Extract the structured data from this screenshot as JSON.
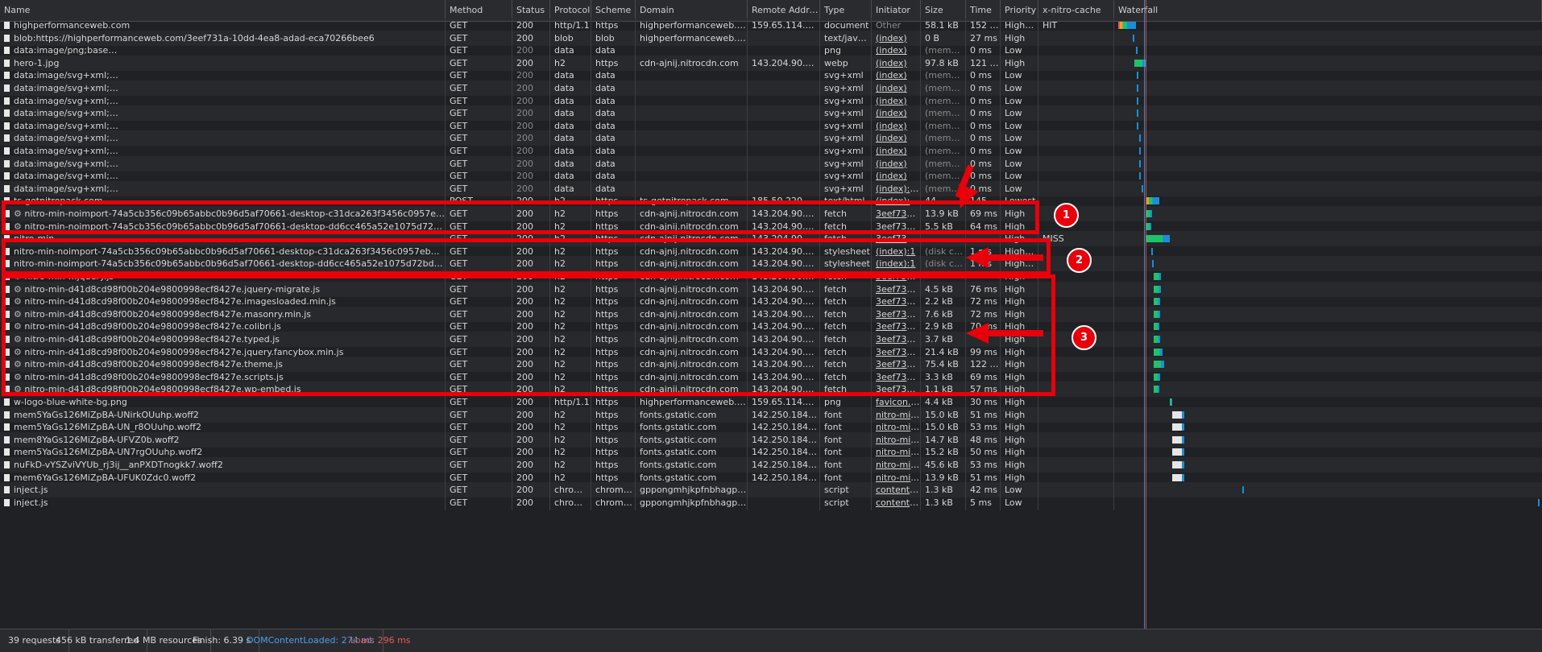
{
  "columns": [
    "Name",
    "Method",
    "Status",
    "Protocol",
    "Scheme",
    "Domain",
    "Remote Address",
    "Type",
    "Initiator",
    "Size",
    "Time",
    "Priority",
    "x-nitro-cache",
    "Waterfall"
  ],
  "rows": [
    {
      "name": "highperformanceweb.com",
      "method": "GET",
      "status": "200",
      "protocol": "http/1.1",
      "scheme": "https",
      "domain": "highperformanceweb.com",
      "remote": "159.65.114.205:443",
      "type": "document",
      "initiator": "Other",
      "size": "58.1 kB",
      "time": "152 ms",
      "priority": "Highest",
      "cache": "HIT"
    },
    {
      "name": "blob:https://highperformanceweb.com/3eef731a-10dd-4ea8-adad-eca70266bee6",
      "method": "GET",
      "status": "200",
      "protocol": "blob",
      "scheme": "blob",
      "domain": "highperformanceweb.com",
      "remote": "",
      "type": "text/javascript",
      "initiator": "(index)",
      "size": "0 B",
      "time": "27 ms",
      "priority": "High",
      "cache": ""
    },
    {
      "name": "data:image/png;base…",
      "method": "GET",
      "status": "200",
      "protocol": "data",
      "scheme": "data",
      "domain": "",
      "remote": "",
      "type": "png",
      "initiator": "(index)",
      "size": "(memory …",
      "time": "0 ms",
      "priority": "Low",
      "cache": ""
    },
    {
      "name": "hero-1.jpg",
      "method": "GET",
      "status": "200",
      "protocol": "h2",
      "scheme": "https",
      "domain": "cdn-ajnij.nitrocdn.com",
      "remote": "143.204.90.129:443",
      "type": "webp",
      "initiator": "(index)",
      "size": "97.8 kB",
      "time": "121 ms",
      "priority": "High",
      "cache": ""
    },
    {
      "name": "data:image/svg+xml;…",
      "method": "GET",
      "status": "200",
      "protocol": "data",
      "scheme": "data",
      "domain": "",
      "remote": "",
      "type": "svg+xml",
      "initiator": "(index)",
      "size": "(memory …",
      "time": "0 ms",
      "priority": "Low",
      "cache": ""
    },
    {
      "name": "data:image/svg+xml;…",
      "method": "GET",
      "status": "200",
      "protocol": "data",
      "scheme": "data",
      "domain": "",
      "remote": "",
      "type": "svg+xml",
      "initiator": "(index)",
      "size": "(memory …",
      "time": "0 ms",
      "priority": "Low",
      "cache": ""
    },
    {
      "name": "data:image/svg+xml;…",
      "method": "GET",
      "status": "200",
      "protocol": "data",
      "scheme": "data",
      "domain": "",
      "remote": "",
      "type": "svg+xml",
      "initiator": "(index)",
      "size": "(memory …",
      "time": "0 ms",
      "priority": "Low",
      "cache": ""
    },
    {
      "name": "data:image/svg+xml;…",
      "method": "GET",
      "status": "200",
      "protocol": "data",
      "scheme": "data",
      "domain": "",
      "remote": "",
      "type": "svg+xml",
      "initiator": "(index)",
      "size": "(memory …",
      "time": "0 ms",
      "priority": "Low",
      "cache": ""
    },
    {
      "name": "data:image/svg+xml;…",
      "method": "GET",
      "status": "200",
      "protocol": "data",
      "scheme": "data",
      "domain": "",
      "remote": "",
      "type": "svg+xml",
      "initiator": "(index)",
      "size": "(memory …",
      "time": "0 ms",
      "priority": "Low",
      "cache": ""
    },
    {
      "name": "data:image/svg+xml;…",
      "method": "GET",
      "status": "200",
      "protocol": "data",
      "scheme": "data",
      "domain": "",
      "remote": "",
      "type": "svg+xml",
      "initiator": "(index)",
      "size": "(memory …",
      "time": "0 ms",
      "priority": "Low",
      "cache": ""
    },
    {
      "name": "data:image/svg+xml;…",
      "method": "GET",
      "status": "200",
      "protocol": "data",
      "scheme": "data",
      "domain": "",
      "remote": "",
      "type": "svg+xml",
      "initiator": "(index)",
      "size": "(memory …",
      "time": "0 ms",
      "priority": "Low",
      "cache": ""
    },
    {
      "name": "data:image/svg+xml;…",
      "method": "GET",
      "status": "200",
      "protocol": "data",
      "scheme": "data",
      "domain": "",
      "remote": "",
      "type": "svg+xml",
      "initiator": "(index)",
      "size": "(memory …",
      "time": "0 ms",
      "priority": "Low",
      "cache": ""
    },
    {
      "name": "data:image/svg+xml;…",
      "method": "GET",
      "status": "200",
      "protocol": "data",
      "scheme": "data",
      "domain": "",
      "remote": "",
      "type": "svg+xml",
      "initiator": "(index)",
      "size": "(memory …",
      "time": "0 ms",
      "priority": "Low",
      "cache": ""
    },
    {
      "name": "data:image/svg+xml;…",
      "method": "GET",
      "status": "200",
      "protocol": "data",
      "scheme": "data",
      "domain": "",
      "remote": "",
      "type": "svg+xml",
      "initiator": "(index):124",
      "size": "(memory …",
      "time": "0 ms",
      "priority": "Low",
      "cache": ""
    },
    {
      "name": "ts-getnitropack.com",
      "method": "POST",
      "status": "200",
      "protocol": "h2",
      "scheme": "https",
      "domain": "ts-getnitropack.com",
      "remote": "185.50.220.104:443",
      "type": "text/html",
      "initiator": "(index):129",
      "size": "44…",
      "time": "145 ms",
      "priority": "Lowest",
      "cache": ""
    },
    {
      "name": "nitro-min-noimport-74a5cb356c09b65abbc0b96d5af70661-desktop-c31dca263f3456c0957eb7137a83ef8d.css",
      "gear": true,
      "method": "GET",
      "status": "200",
      "protocol": "h2",
      "scheme": "https",
      "domain": "cdn-ajnij.nitrocdn.com",
      "remote": "143.204.90.129:443",
      "type": "fetch",
      "initiator": "3eef731a-1…",
      "size": "13.9 kB",
      "time": "69 ms",
      "priority": "High",
      "cache": ""
    },
    {
      "name": "nitro-min-noimport-74a5cb356c09b65abbc0b96d5af70661-desktop-dd6cc465a52e1075d72bd91e199b4383.css",
      "gear": true,
      "method": "GET",
      "status": "200",
      "protocol": "h2",
      "scheme": "https",
      "domain": "cdn-ajnij.nitrocdn.com",
      "remote": "143.204.90.129:443",
      "type": "fetch",
      "initiator": "3eef731a-1…",
      "size": "5.5 kB",
      "time": "64 ms",
      "priority": "High",
      "cache": ""
    },
    {
      "name": "nitro-min-…",
      "method": "GET",
      "status": "200",
      "protocol": "h2",
      "scheme": "https",
      "domain": "cdn-ajnij.nitrocdn.com",
      "remote": "143.204.90.129:443",
      "type": "fetch",
      "initiator": "3eef731a-1…",
      "size": "",
      "time": "",
      "priority": "High",
      "cache": "MISS"
    },
    {
      "name": "nitro-min-noimport-74a5cb356c09b65abbc0b96d5af70661-desktop-c31dca263f3456c0957eb7137a83ef8d.css",
      "method": "GET",
      "status": "200",
      "protocol": "h2",
      "scheme": "https",
      "domain": "cdn-ajnij.nitrocdn.com",
      "remote": "143.204.90.129:443",
      "type": "stylesheet",
      "initiator": "(index):1",
      "size": "(disk cache)",
      "time": "1 ms",
      "priority": "Highest",
      "cache": ""
    },
    {
      "name": "nitro-min-noimport-74a5cb356c09b65abbc0b96d5af70661-desktop-dd6cc465a52e1075d72bd91e199b4383.css",
      "method": "GET",
      "status": "200",
      "protocol": "h2",
      "scheme": "https",
      "domain": "cdn-ajnij.nitrocdn.com",
      "remote": "143.204.90.129:443",
      "type": "stylesheet",
      "initiator": "(index):1",
      "size": "(disk cache)",
      "time": "1 ms",
      "priority": "Highest",
      "cache": ""
    },
    {
      "name": "nitro-min-…jquery.js",
      "gear": true,
      "method": "GET",
      "status": "200",
      "protocol": "h2",
      "scheme": "https",
      "domain": "cdn-ajnij.nitrocdn.com",
      "remote": "143.204.90.129:443",
      "type": "fetch",
      "initiator": "3eef731a-1…",
      "size": "",
      "time": "",
      "priority": "High",
      "cache": ""
    },
    {
      "name": "nitro-min-d41d8cd98f00b204e9800998ecf8427e.jquery-migrate.js",
      "gear": true,
      "method": "GET",
      "status": "200",
      "protocol": "h2",
      "scheme": "https",
      "domain": "cdn-ajnij.nitrocdn.com",
      "remote": "143.204.90.129:443",
      "type": "fetch",
      "initiator": "3eef731a-1…",
      "size": "4.5 kB",
      "time": "76 ms",
      "priority": "High",
      "cache": ""
    },
    {
      "name": "nitro-min-d41d8cd98f00b204e9800998ecf8427e.imagesloaded.min.js",
      "gear": true,
      "method": "GET",
      "status": "200",
      "protocol": "h2",
      "scheme": "https",
      "domain": "cdn-ajnij.nitrocdn.com",
      "remote": "143.204.90.129:443",
      "type": "fetch",
      "initiator": "3eef731a-1…",
      "size": "2.2 kB",
      "time": "72 ms",
      "priority": "High",
      "cache": ""
    },
    {
      "name": "nitro-min-d41d8cd98f00b204e9800998ecf8427e.masonry.min.js",
      "gear": true,
      "method": "GET",
      "status": "200",
      "protocol": "h2",
      "scheme": "https",
      "domain": "cdn-ajnij.nitrocdn.com",
      "remote": "143.204.90.129:443",
      "type": "fetch",
      "initiator": "3eef731a-1…",
      "size": "7.6 kB",
      "time": "72 ms",
      "priority": "High",
      "cache": ""
    },
    {
      "name": "nitro-min-d41d8cd98f00b204e9800998ecf8427e.colibri.js",
      "gear": true,
      "method": "GET",
      "status": "200",
      "protocol": "h2",
      "scheme": "https",
      "domain": "cdn-ajnij.nitrocdn.com",
      "remote": "143.204.90.129:443",
      "type": "fetch",
      "initiator": "3eef731a-1…",
      "size": "2.9 kB",
      "time": "70 ms",
      "priority": "High",
      "cache": ""
    },
    {
      "name": "nitro-min-d41d8cd98f00b204e9800998ecf8427e.typed.js",
      "gear": true,
      "method": "GET",
      "status": "200",
      "protocol": "h2",
      "scheme": "https",
      "domain": "cdn-ajnij.nitrocdn.com",
      "remote": "143.204.90.129:443",
      "type": "fetch",
      "initiator": "3eef731a-1…",
      "size": "3.7 kB",
      "time": "",
      "priority": "High",
      "cache": ""
    },
    {
      "name": "nitro-min-d41d8cd98f00b204e9800998ecf8427e.jquery.fancybox.min.js",
      "gear": true,
      "method": "GET",
      "status": "200",
      "protocol": "h2",
      "scheme": "https",
      "domain": "cdn-ajnij.nitrocdn.com",
      "remote": "143.204.90.129:443",
      "type": "fetch",
      "initiator": "3eef731a-1…",
      "size": "21.4 kB",
      "time": "99 ms",
      "priority": "High",
      "cache": ""
    },
    {
      "name": "nitro-min-d41d8cd98f00b204e9800998ecf8427e.theme.js",
      "gear": true,
      "method": "GET",
      "status": "200",
      "protocol": "h2",
      "scheme": "https",
      "domain": "cdn-ajnij.nitrocdn.com",
      "remote": "143.204.90.129:443",
      "type": "fetch",
      "initiator": "3eef731a-1…",
      "size": "75.4 kB",
      "time": "122 ms",
      "priority": "High",
      "cache": ""
    },
    {
      "name": "nitro-min-d41d8cd98f00b204e9800998ecf8427e.scripts.js",
      "gear": true,
      "method": "GET",
      "status": "200",
      "protocol": "h2",
      "scheme": "https",
      "domain": "cdn-ajnij.nitrocdn.com",
      "remote": "143.204.90.129:443",
      "type": "fetch",
      "initiator": "3eef731a-1…",
      "size": "3.3 kB",
      "time": "69 ms",
      "priority": "High",
      "cache": ""
    },
    {
      "name": "nitro-min-d41d8cd98f00b204e9800998ecf8427e.wp-embed.js",
      "gear": true,
      "method": "GET",
      "status": "200",
      "protocol": "h2",
      "scheme": "https",
      "domain": "cdn-ajnij.nitrocdn.com",
      "remote": "143.204.90.129:443",
      "type": "fetch",
      "initiator": "3eef731a-1…",
      "size": "1.1 kB",
      "time": "57 ms",
      "priority": "High",
      "cache": ""
    },
    {
      "name": "w-logo-blue-white-bg.png",
      "method": "GET",
      "status": "200",
      "protocol": "http/1.1",
      "scheme": "https",
      "domain": "highperformanceweb.com",
      "remote": "159.65.114.205:443",
      "type": "png",
      "initiator": "favicon.ico",
      "size": "4.4 kB",
      "time": "30 ms",
      "priority": "High",
      "cache": ""
    },
    {
      "name": "mem5YaGs126MiZpBA-UNirkOUuhp.woff2",
      "method": "GET",
      "status": "200",
      "protocol": "h2",
      "scheme": "https",
      "domain": "fonts.gstatic.com",
      "remote": "142.250.184.131:4…",
      "type": "font",
      "initiator": "nitro-min-n…",
      "size": "15.0 kB",
      "time": "51 ms",
      "priority": "High",
      "cache": ""
    },
    {
      "name": "mem5YaGs126MiZpBA-UN_r8OUuhp.woff2",
      "method": "GET",
      "status": "200",
      "protocol": "h2",
      "scheme": "https",
      "domain": "fonts.gstatic.com",
      "remote": "142.250.184.131:4…",
      "type": "font",
      "initiator": "nitro-min-n…",
      "size": "15.0 kB",
      "time": "53 ms",
      "priority": "High",
      "cache": ""
    },
    {
      "name": "mem8YaGs126MiZpBA-UFVZ0b.woff2",
      "method": "GET",
      "status": "200",
      "protocol": "h2",
      "scheme": "https",
      "domain": "fonts.gstatic.com",
      "remote": "142.250.184.131:4…",
      "type": "font",
      "initiator": "nitro-min-n…",
      "size": "14.7 kB",
      "time": "48 ms",
      "priority": "High",
      "cache": ""
    },
    {
      "name": "mem5YaGs126MiZpBA-UN7rgOUuhp.woff2",
      "method": "GET",
      "status": "200",
      "protocol": "h2",
      "scheme": "https",
      "domain": "fonts.gstatic.com",
      "remote": "142.250.184.131:4…",
      "type": "font",
      "initiator": "nitro-min-n…",
      "size": "15.2 kB",
      "time": "50 ms",
      "priority": "High",
      "cache": ""
    },
    {
      "name": "nuFkD-vYSZviVYUb_rj3ij__anPXDTnogkk7.woff2",
      "method": "GET",
      "status": "200",
      "protocol": "h2",
      "scheme": "https",
      "domain": "fonts.gstatic.com",
      "remote": "142.250.184.131:4…",
      "type": "font",
      "initiator": "nitro-min-n…",
      "size": "45.6 kB",
      "time": "53 ms",
      "priority": "High",
      "cache": ""
    },
    {
      "name": "mem6YaGs126MiZpBA-UFUK0Zdc0.woff2",
      "method": "GET",
      "status": "200",
      "protocol": "h2",
      "scheme": "https",
      "domain": "fonts.gstatic.com",
      "remote": "142.250.184.131:4…",
      "type": "font",
      "initiator": "nitro-min-n…",
      "size": "13.9 kB",
      "time": "51 ms",
      "priority": "High",
      "cache": ""
    },
    {
      "name": "inject.js",
      "method": "GET",
      "status": "200",
      "protocol": "chrome-…",
      "scheme": "chrome-e…",
      "domain": "gppongmhjkpfnbhagpmjfkannfb…",
      "remote": "",
      "type": "script",
      "initiator": "content.js:…",
      "size": "1.3 kB",
      "time": "42 ms",
      "priority": "Low",
      "cache": ""
    },
    {
      "name": "inject.js",
      "method": "GET",
      "status": "200",
      "protocol": "chrome-…",
      "scheme": "chrome-e…",
      "domain": "gppongmhjkpfnbhagpmjfkannfb…",
      "remote": "",
      "type": "script",
      "initiator": "content.js:…",
      "size": "1.3 kB",
      "time": "5 ms",
      "priority": "Low",
      "cache": ""
    }
  ],
  "summary": {
    "requests": "39 requests",
    "transferred": "456 kB transferred",
    "resources": "1.4 MB resources",
    "finish": "Finish: 6.39 s",
    "dcl": "DOMContentLoaded: 274 ms",
    "load": "Load: 296 ms"
  },
  "annotations": [
    "1",
    "2",
    "3"
  ],
  "colors": {
    "background": "#202124",
    "annotation_red": "#e8000b",
    "dcl_blue": "#4a9fe8",
    "load_red": "#e35a5a",
    "waterfall_green": "#1fc16b",
    "waterfall_blue": "#1a8fd8"
  },
  "icons": {
    "file": "file-icon",
    "gear": "gear-icon"
  }
}
